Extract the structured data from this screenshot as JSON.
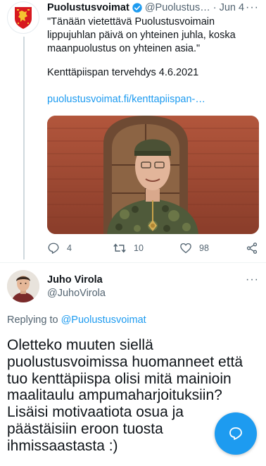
{
  "tweet": {
    "author": "Puolustusvoimat",
    "handle": "@Puolustus…",
    "date": "Jun 4",
    "separator": "·",
    "more": "···",
    "text_lines": [
      "\"Tänään vietettävä Puolustusvoimain",
      "lippujuhlan päivä on yhteinen juhla, koska",
      "maanpuolustus on yhteinen asia.\""
    ],
    "signature": "Kenttäpiispan tervehdys 4.6.2021",
    "link": "puolustusvoimat.fi/kenttapiispan-…",
    "counts": {
      "replies": "4",
      "retweets": "10",
      "likes": "98"
    }
  },
  "reply": {
    "author": "Juho Virola",
    "handle": "@JuhoVirola",
    "more": "···",
    "replying_prefix": "Replying to",
    "replying_to": "@Puolustusvoimat",
    "text_lines": [
      "Oletteko muuten siellä",
      "puolustusvoimissa huomanneet että",
      "tuo kenttäpiispa olisi mitä mainioin",
      "maalitaulu ampumaharjoituksiin?",
      "Lisäisi motivaatiota osua ja",
      "päästäisiin eroon tuosta",
      "ihmissaastasta :)"
    ]
  },
  "colors": {
    "accent": "#1d9bf0",
    "secondary_text": "#536471",
    "primary_text": "#0f1419"
  },
  "icons": {
    "verified": "verified-badge-icon",
    "reply": "reply-icon",
    "retweet": "retweet-icon",
    "like": "heart-icon",
    "share": "share-icon",
    "compose": "compose-icon"
  }
}
